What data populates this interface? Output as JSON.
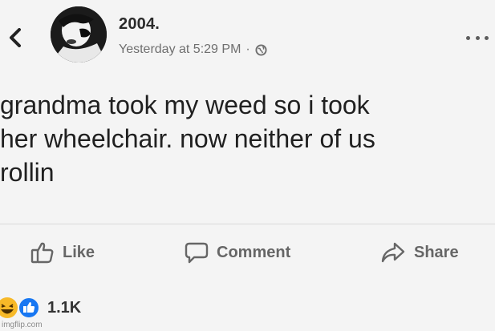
{
  "post": {
    "author": "2004.",
    "timestamp": "Yesterday at 5:29 PM",
    "separator": "·",
    "privacy_icon": "globe-icon",
    "text": "grandma took my weed so i took\nher wheelchair. now neither of us\nrollin"
  },
  "actions": {
    "like_label": "Like",
    "comment_label": "Comment",
    "share_label": "Share"
  },
  "reactions": {
    "count": "1.1K",
    "icons": [
      "haha-reaction-icon",
      "like-reaction-icon"
    ]
  },
  "watermark": "imgflip.com",
  "colors": {
    "background": "#f4f4f4",
    "primary_text": "#202020",
    "secondary_text": "#6f6f6f",
    "action_text": "#666666",
    "like_blue": "#1877f2",
    "haha_yellow": "#f7b928"
  }
}
